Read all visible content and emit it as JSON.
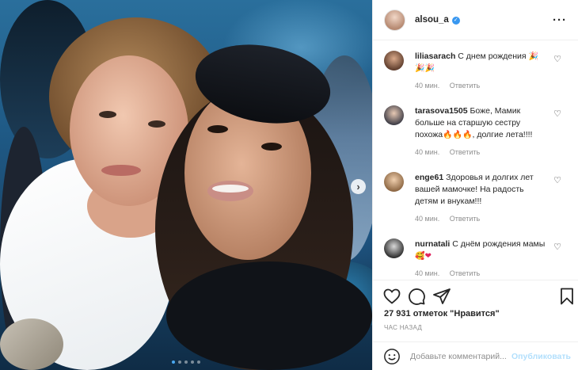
{
  "post": {
    "username": "alsou_a",
    "likes_text": "27 931 отметок \"Нравится\"",
    "time_ago": "ЧАС НАЗАД",
    "carousel": {
      "total": 5,
      "active": 1
    }
  },
  "comments": [
    {
      "user": "liliasarach",
      "text": "С днем рождения",
      "emoji_after": [
        "party-popper",
        "party-popper",
        "party-popper"
      ],
      "time": "40 мин.",
      "reply": "Ответить"
    },
    {
      "user": "tarasova1505",
      "text": "Боже, Мамик больше на старшую сестру похожа",
      "emoji_after": [
        "fire",
        "fire",
        "fire"
      ],
      "text_after": ", долгие лета!!!!",
      "time": "40 мин.",
      "reply": "Ответить"
    },
    {
      "user": "enge61",
      "text": "Здоровья и долгих лет вашей мамочке! На радость детям и внукам!!!",
      "time": "40 мин.",
      "reply": "Ответить"
    },
    {
      "user": "nurnatali",
      "text": "С днём рождения мамы",
      "emoji_after": [
        "smiling-face-with-hearts",
        "red-heart"
      ],
      "time": "40 мин.",
      "reply": "Ответить"
    }
  ],
  "add_comment": {
    "placeholder": "Добавьте комментарий...",
    "post_label": "Опубликовать"
  },
  "colors": {
    "accent": "#3897f0",
    "post_disabled": "#b2dffc",
    "meta": "#8e8e8e",
    "border": "#efefef"
  },
  "icons": [
    "more-icon",
    "heart-icon",
    "comment-icon",
    "share-icon",
    "bookmark-icon",
    "smile-icon",
    "verified-icon",
    "chevron-right-icon"
  ]
}
